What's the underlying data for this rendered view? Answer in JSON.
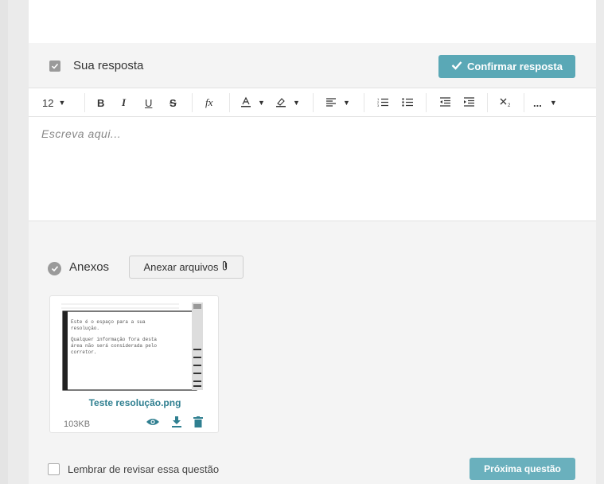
{
  "answer": {
    "title": "Sua resposta",
    "confirm_label": "Confirmar resposta"
  },
  "toolbar": {
    "font_size": "12",
    "bold": "B",
    "italic": "I",
    "underline": "U",
    "strike": "S",
    "formula": "fx",
    "more": "..."
  },
  "editor": {
    "placeholder": "Escreva aqui..."
  },
  "attachments": {
    "title": "Anexos",
    "attach_button": "Anexar arquivos",
    "file": {
      "name": "Teste resolução.png",
      "size": "103KB",
      "thumbnail_text": [
        "Este é o espaço para a sua",
        "resolução.",
        "Qualquer informação fora desta",
        "área não será considerada pelo",
        "corretor."
      ]
    }
  },
  "footer": {
    "remember_label": "Lembrar de revisar essa questão",
    "next_label": "Próxima questão"
  },
  "colors": {
    "accent": "#5aa8b6",
    "link": "#2f7f90"
  }
}
